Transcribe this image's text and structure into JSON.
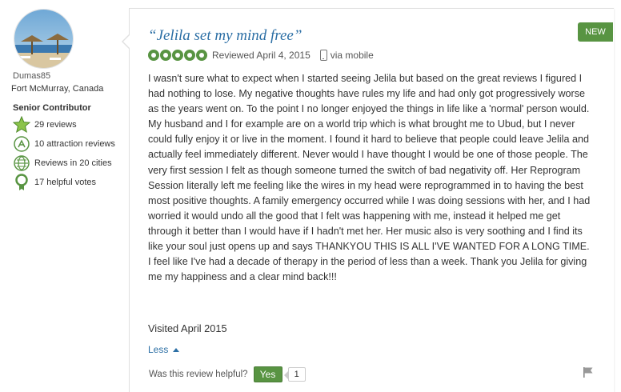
{
  "reviewer": {
    "username": "Dumas85",
    "location": "Fort McMurray, Canada",
    "badge": "Senior Contributor",
    "stats": [
      {
        "icon": "star-badge-icon",
        "label": "29 reviews"
      },
      {
        "icon": "attraction-icon",
        "label": "10 attraction reviews"
      },
      {
        "icon": "globe-icon",
        "label": "Reviews in 20 cities"
      },
      {
        "icon": "helpful-votes-icon",
        "label": "17 helpful votes"
      }
    ]
  },
  "review": {
    "new_label": "NEW",
    "title": "“Jelila set my mind free”",
    "rating": 5,
    "reviewed_date": "Reviewed April 4, 2015",
    "via": "via mobile",
    "body": "I wasn't sure what to expect when I started seeing Jelila but based on the great reviews I figured I had nothing to lose. My negative thoughts have rules my life and had only got progressively worse as the years went on. To the point I no longer enjoyed the things in life like a 'normal' person would. My husband and I for example are on a world trip which is what brought me to Ubud, but I never could fully enjoy it or live in the moment. I found it hard to believe that people could leave Jelila and actually feel immediately different. Never would I have thought I would be one of those people. The very first session I felt as though someone turned the switch of bad negativity off. Her Reprogram Session literally left me feeling like the wires in my head were reprogrammed in to having the best most positive thoughts. A family emergency occurred while I was doing sessions with her, and I had worried it would undo all the good that I felt was happening with me, instead it helped me get through it better than I would have if I hadn't met her. Her music also is very soothing and I find its like your soul just opens up and says THANKYOU THIS IS ALL I'VE WANTED FOR A LONG TIME. I feel like I've had a decade of therapy in the period of less than a week. Thank you Jelila for giving me my happiness and a clear mind back!!!",
    "visited": "Visited April 2015",
    "less_label": "Less",
    "helpful_question": "Was this review helpful?",
    "yes_label": "Yes",
    "helpful_count": "1"
  },
  "colors": {
    "brand_green": "#589442",
    "link_blue": "#2c6fa5"
  }
}
